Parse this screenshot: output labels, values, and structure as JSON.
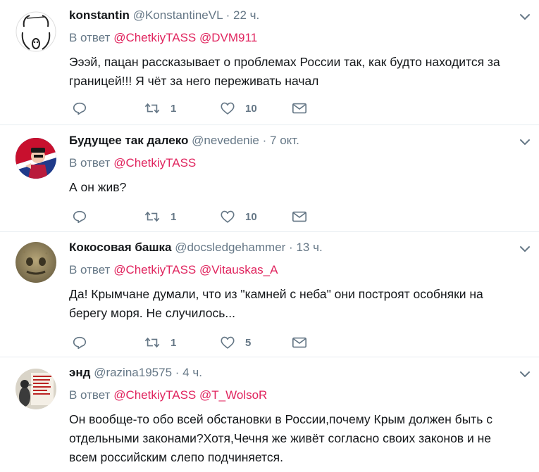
{
  "tweets": [
    {
      "name": "konstantin",
      "handle": "@KonstantineVL",
      "dot": "·",
      "time": "22 ч.",
      "reply_prefix": "В ответ",
      "mentions": [
        "@ChetkiyTASS",
        "@DVM911"
      ],
      "text": "Эээй, пацан рассказывает о проблемах России так, как будто находится за границей!!! Я чёт за него переживать начал",
      "retweets": "1",
      "likes": "10"
    },
    {
      "name": "Будущее так далеко",
      "handle": "@nevedenie",
      "dot": "·",
      "time": "7 окт.",
      "reply_prefix": "В ответ",
      "mentions": [
        "@ChetkiyTASS"
      ],
      "text": "А он жив?",
      "retweets": "1",
      "likes": "10"
    },
    {
      "name": "Кокосовая башка",
      "handle": "@docsledgehammer",
      "dot": "·",
      "time": "13 ч.",
      "reply_prefix": "В ответ",
      "mentions": [
        "@ChetkiyTASS",
        "@Vitauskas_A"
      ],
      "text": "Да! Крымчане думали, что из \"камней с неба\" они построят особняки на берегу моря. Не случилось...",
      "retweets": "1",
      "likes": "5"
    },
    {
      "name": "энд",
      "handle": "@razina19575",
      "dot": "·",
      "time": "4 ч.",
      "reply_prefix": "В ответ",
      "mentions": [
        "@ChetkiyTASS",
        "@T_WolsoR"
      ],
      "text": "Он вообще-то обо всей обстановки в России,почему Крым должен быть с отдельными законами?Хотя,Чечня же живёт согласно своих законов и не всем российским слепо подчиняется."
    }
  ],
  "icons": {
    "reply": "reply-icon",
    "retweet": "retweet-icon",
    "like": "heart-icon",
    "dm": "envelope-icon",
    "menu": "chevron-down-icon"
  },
  "colors": {
    "mention": "#e0245e",
    "muted": "#657786",
    "text": "#14171a",
    "divider": "#e6ecf0"
  }
}
